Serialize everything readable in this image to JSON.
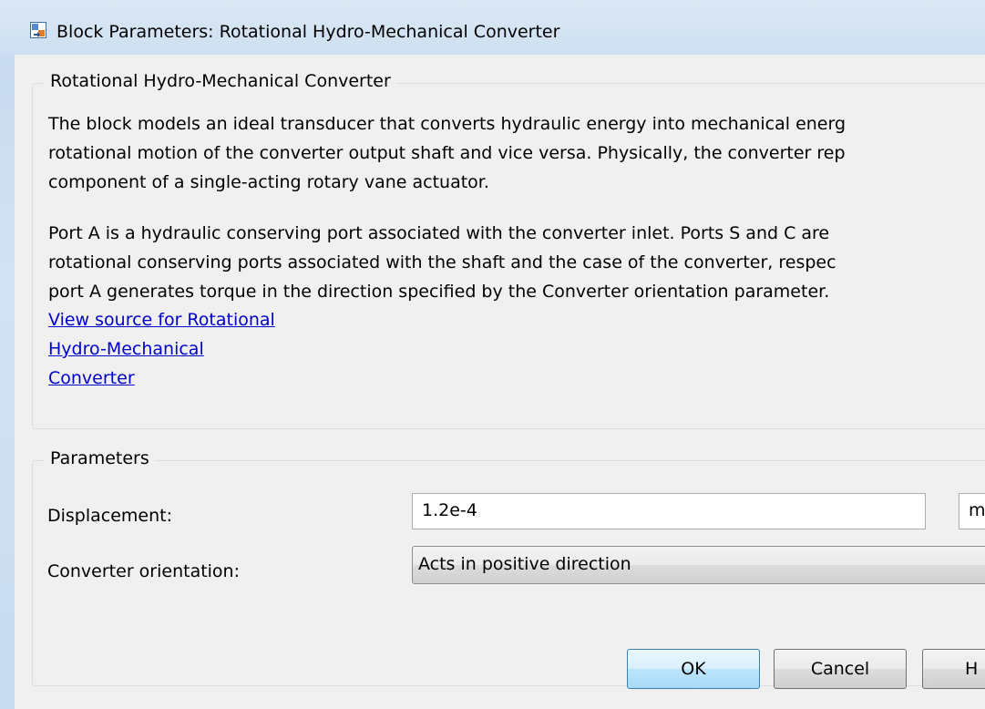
{
  "window": {
    "title": "Block Parameters: Rotational Hydro-Mechanical Converter",
    "icon": "simulink-block-icon"
  },
  "description": {
    "group_title": "Rotational Hydro-Mechanical Converter",
    "paragraph1": [
      "The block models an ideal transducer that converts hydraulic energy into mechanical energ",
      "rotational motion of the converter output shaft and vice versa. Physically, the converter rep",
      "component of a single-acting rotary vane actuator."
    ],
    "paragraph2": [
      "Port A is a hydraulic conserving port associated with the converter inlet. Ports S and C are",
      "rotational conserving ports associated with the shaft and the case of the converter, respec",
      "port A generates torque in the direction specified by the Converter orientation parameter."
    ],
    "link_lines": [
      "View source for Rotational",
      "Hydro-Mechanical",
      "Converter"
    ]
  },
  "parameters": {
    "group_title": "Parameters",
    "displacement": {
      "label": "Displacement:",
      "value": "1.2e-4",
      "units": "m"
    },
    "orientation": {
      "label": "Converter orientation:",
      "selected": "Acts in positive direction"
    }
  },
  "buttons": {
    "ok": "OK",
    "cancel": "Cancel",
    "help": "H"
  }
}
